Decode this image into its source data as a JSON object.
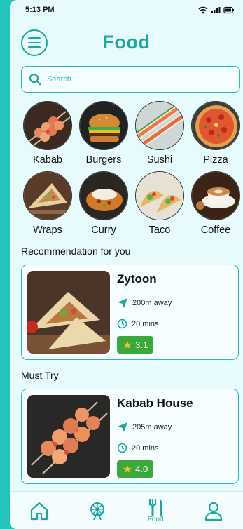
{
  "status": {
    "time": "5:13 PM"
  },
  "header": {
    "title": "Food"
  },
  "search": {
    "placeholder": "Search"
  },
  "categories": [
    {
      "label": "Kabab"
    },
    {
      "label": "Burgers"
    },
    {
      "label": "Sushi"
    },
    {
      "label": "Pizza"
    },
    {
      "label": "Wraps"
    },
    {
      "label": "Curry"
    },
    {
      "label": "Taco"
    },
    {
      "label": "Coffee"
    }
  ],
  "recommendation": {
    "title": "Recommendation for you",
    "name": "Zytoon",
    "distance": "200m away",
    "time": "20 mins",
    "rating": "3.1"
  },
  "must_try": {
    "title": "Must Try",
    "name": "Kabab House",
    "distance": "205m away",
    "time": "20 mins",
    "rating": "4.0"
  },
  "bottom_nav": {
    "food_label": "Food"
  },
  "colors": {
    "accent": "#1aa79f",
    "rating_bg": "#3aa83a",
    "star": "#f6c026"
  }
}
